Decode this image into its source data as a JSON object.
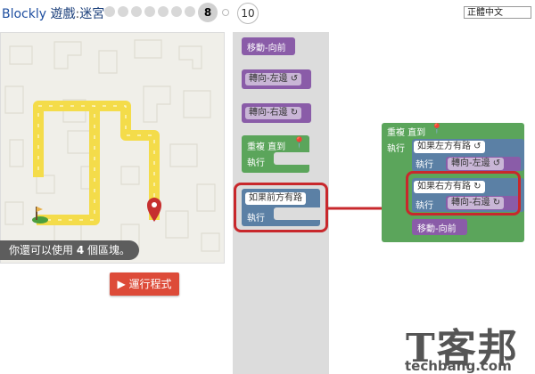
{
  "header": {
    "app_name": "Blockly",
    "game_label": "遊戲",
    "separator": ":",
    "game_name": "迷宮",
    "current_level": "8",
    "last_level": "10",
    "language": "正體中文"
  },
  "maze": {
    "capacity_prefix": "你還可以使用 ",
    "capacity_number": "4",
    "capacity_suffix": " 個區塊。"
  },
  "run_button": {
    "label": "運行程式",
    "icon": "play-icon"
  },
  "toolbox": {
    "move_forward": "移動-向前",
    "turn_left": "轉向-左邊 ↺",
    "turn_right": "轉向-右邊 ↻",
    "repeat_until": "重複 直到",
    "do_label": "執行",
    "if_path_ahead": "如果前方有路"
  },
  "workspace": {
    "repeat_until": "重複 直到",
    "do_label": "執行",
    "if_path_left": "如果左方有路 ↺",
    "turn_left": "轉向-左邊 ↺",
    "if_path_right": "如果右方有路 ↻",
    "turn_right": "轉向-右邊 ↻",
    "move_forward": "移動-向前"
  },
  "watermark": {
    "title": "T客邦",
    "url": "techbang.com"
  },
  "colors": {
    "motion_purple": "#8a5ca8",
    "logic_blue": "#5b80a5",
    "loop_green": "#5ba55b",
    "path_yellow": "#f4dc4a",
    "run_red": "#dd4b39",
    "highlight_red": "#c8282c"
  }
}
